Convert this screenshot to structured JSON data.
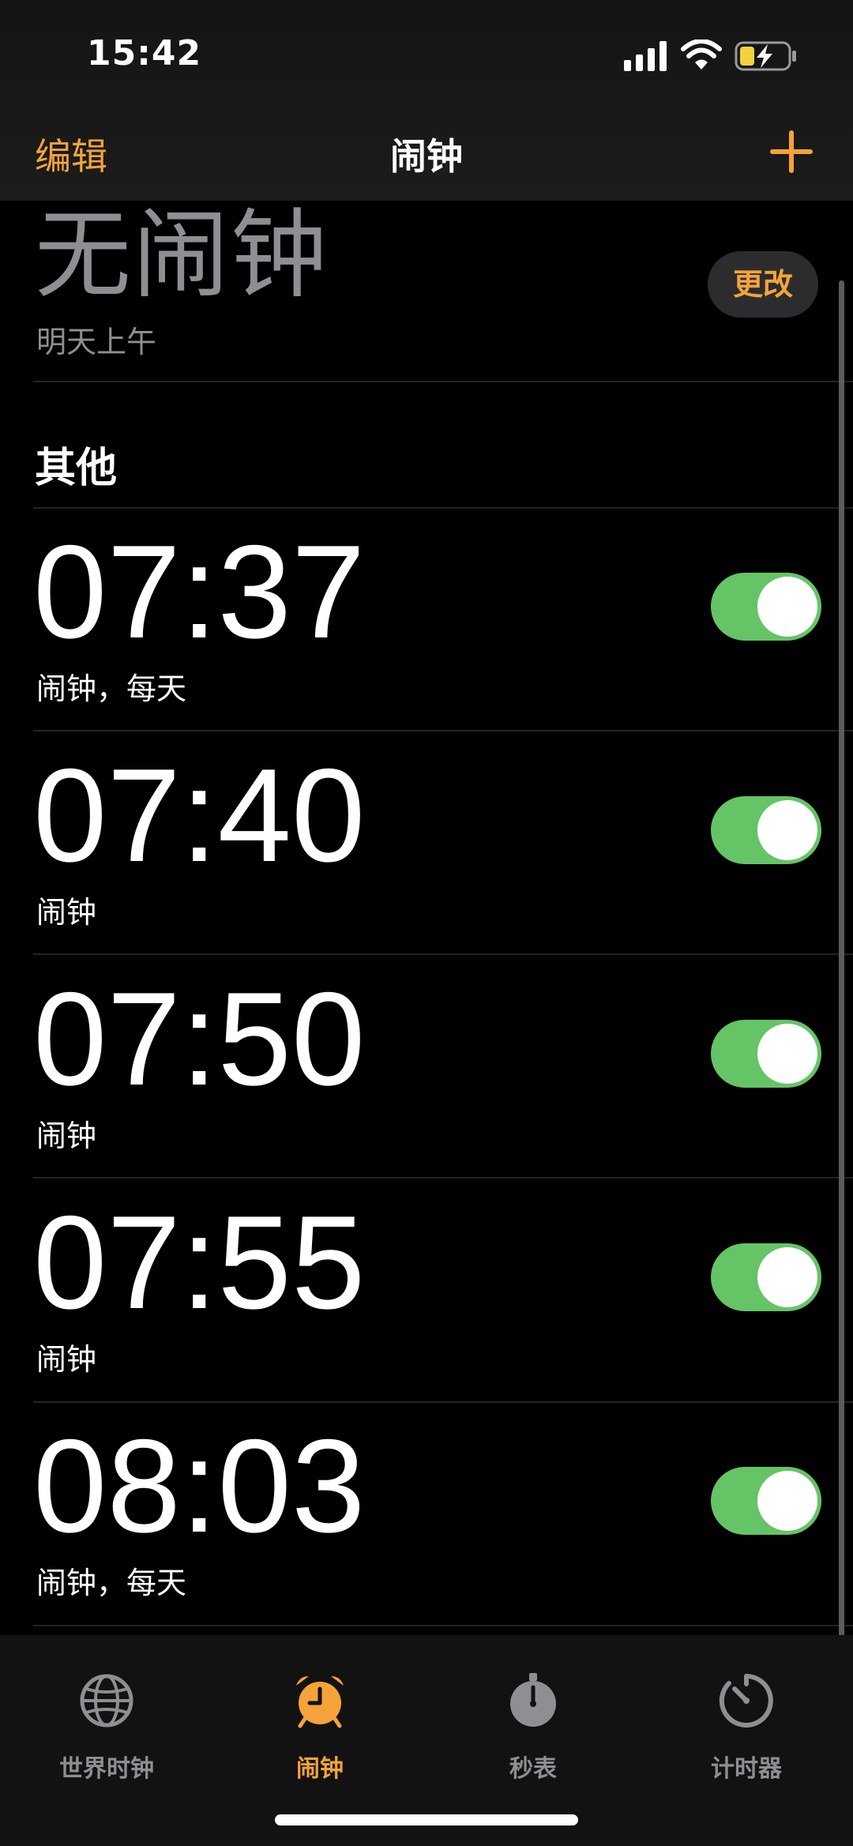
{
  "status_bar": {
    "time": "15:42",
    "icons": [
      "signal-icon",
      "wifi-icon",
      "battery-charging-icon"
    ]
  },
  "nav": {
    "edit_label": "编辑",
    "title": "闹钟",
    "add_icon": "plus-icon"
  },
  "sleep": {
    "title": "无闹钟",
    "subtitle": "明天上午",
    "change_label": "更改"
  },
  "section_other": "其他",
  "alarms": [
    {
      "time": "07:37",
      "label": "闹钟，每天",
      "enabled": true
    },
    {
      "time": "07:40",
      "label": "闹钟",
      "enabled": true
    },
    {
      "time": "07:50",
      "label": "闹钟",
      "enabled": true
    },
    {
      "time": "07:55",
      "label": "闹钟",
      "enabled": true
    },
    {
      "time": "08:03",
      "label": "闹钟，每天",
      "enabled": true
    }
  ],
  "tabs": [
    {
      "label": "世界时钟",
      "icon": "globe-icon",
      "active": false
    },
    {
      "label": "闹钟",
      "icon": "alarm-clock-icon",
      "active": true
    },
    {
      "label": "秒表",
      "icon": "stopwatch-icon",
      "active": false
    },
    {
      "label": "计时器",
      "icon": "timer-icon",
      "active": false
    }
  ],
  "colors": {
    "accent": "#F5A33A",
    "toggle_on": "#65C466",
    "secondary_text": "#8e8e93"
  }
}
